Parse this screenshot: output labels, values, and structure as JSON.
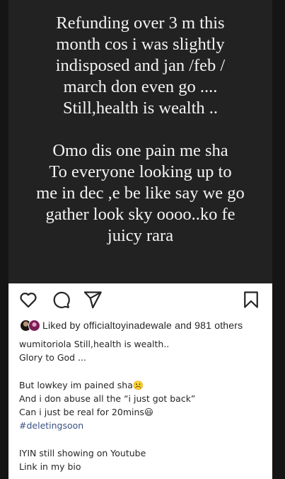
{
  "story": {
    "paragraph1": [
      "Refunding over 3 m this",
      "month cos i was slightly",
      "indisposed and jan /feb /",
      "march don even go ....",
      "Still,health is wealth .."
    ],
    "paragraph2": [
      "Omo dis one pain me sha",
      "To everyone looking up to",
      "me in dec ,e be like say we go",
      "gather look sky oooo..ko fe",
      "juicy rara"
    ]
  },
  "actions": {
    "icons": [
      "heart-icon",
      "comment-icon",
      "share-icon",
      "bookmark-icon"
    ]
  },
  "likes": {
    "prefix": "Liked by",
    "user": "officialtoyinadewale",
    "connector": "and",
    "others": "981 others"
  },
  "caption": {
    "username": "wumitoriola",
    "lines": [
      "Still,health is wealth..",
      "Glory to God ...",
      "",
      "But lowkey im pained sha☹️",
      "And i don abuse all the “i just got back”",
      "Can i just be real for 20mins😃",
      "#deletingsoon",
      "",
      "IYIN still showing on Youtube",
      "Link in my bio"
    ]
  },
  "colors": {
    "background": "#151515",
    "story_bg": "#222222",
    "text": "#262626",
    "hashtag": "#385185"
  }
}
